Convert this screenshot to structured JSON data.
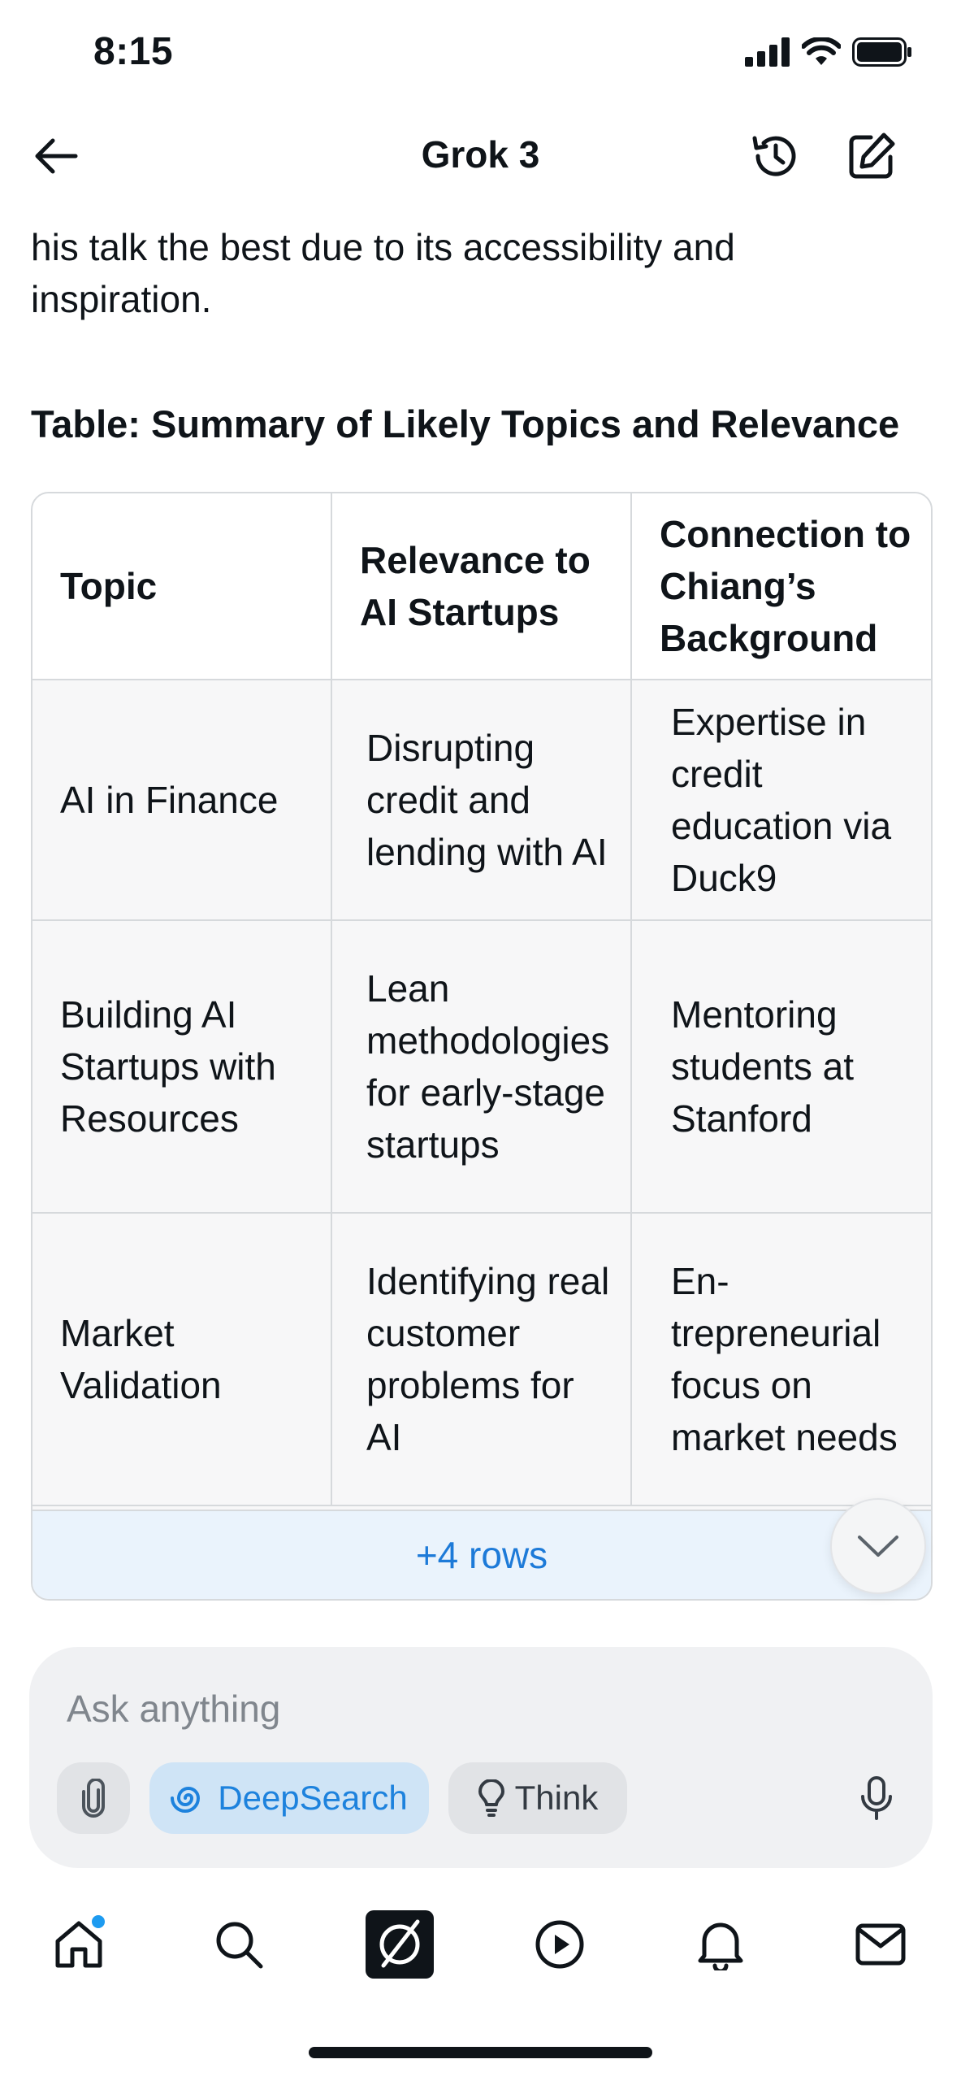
{
  "status_bar": {
    "time": "8:15"
  },
  "header": {
    "title": "Grok 3"
  },
  "content": {
    "intro_text": "his talk the best due to its accessibility and inspiration.",
    "table_title": "Table: Summary of Likely Topics and Relevance"
  },
  "table": {
    "headers": [
      "Topic",
      "Relevance to AI Startups",
      "Connection to Chiang’s Background"
    ],
    "rows": [
      [
        "AI in Finance",
        "Disrupting credit and lending with AI",
        "Expertise in credit education via Duck9"
      ],
      [
        "Building AI Startups with Resources",
        "Lean methodolo­gies for early-stage startups",
        "Mentoring students at Stanford"
      ],
      [
        "Market Validation",
        "Identifying real customer problems for AI",
        "En­trepreneurial focus on market needs"
      ]
    ],
    "more_rows_label": "+4 rows"
  },
  "composer": {
    "placeholder": "Ask anything",
    "deepsearch_label": "DeepSearch",
    "think_label": "Think"
  },
  "colors": {
    "accent": "#1d82dd",
    "deepsearch_bg": "#cfe4f6",
    "more_rows_bg": "#eaf3fc",
    "notification_dot": "#1d9bf0"
  },
  "icons": {
    "status": [
      "signal-icon",
      "wifi-icon",
      "battery-icon"
    ],
    "header": [
      "back-arrow-icon",
      "history-icon",
      "compose-icon"
    ],
    "composer": [
      "paperclip-icon",
      "deepsearch-swirl-icon",
      "lightbulb-icon",
      "microphone-icon"
    ],
    "nav": [
      "home-icon",
      "search-icon",
      "grok-logo-icon",
      "play-icon",
      "bell-icon",
      "mail-icon"
    ]
  }
}
